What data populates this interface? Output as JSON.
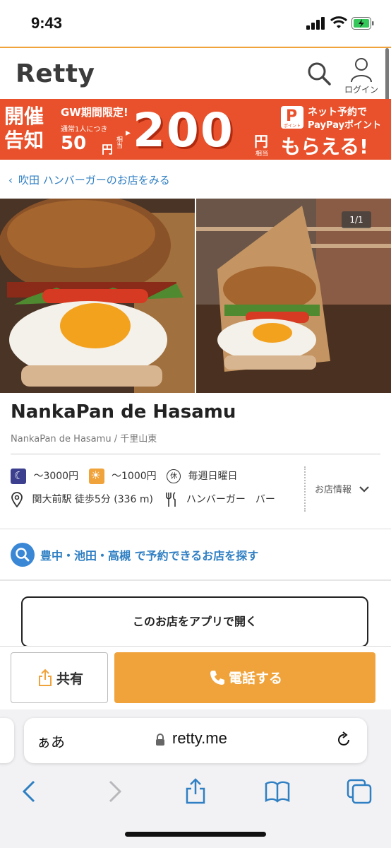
{
  "status": {
    "time": "9:43"
  },
  "header": {
    "logo": "Retty",
    "login": "ログイン"
  },
  "banner": {
    "announce": "開催\n告知",
    "gw": "GW期間限定!",
    "per_person": "通常1人につき",
    "base_points": "50",
    "yen": "円",
    "equiv": "相当",
    "big_points": "200",
    "yen2": "円",
    "equiv2": "相当",
    "paypay_icon_text": "ポイント",
    "net_reserve": "ネット予約で",
    "paypay_point": "PayPayポイント",
    "get": "もらえる!"
  },
  "breadcrumb": {
    "label": "吹田 ハンバーガーのお店をみる"
  },
  "photos": {
    "counter": "1/1"
  },
  "restaurant": {
    "name": "NankaPan de Hasamu",
    "subtitle": "NankaPan de Hasamu / 千里山東",
    "dinner_budget": "～3000円",
    "lunch_budget": "～1000円",
    "closed_icon": "休",
    "closed_day": "毎週日曜日",
    "access": "関大前駅 徒歩5分 (336 m)",
    "genre": "ハンバーガー　バー",
    "shop_info": "お店情報"
  },
  "find": {
    "label": "豊中・池田・高槻 で予約できるお店を探す"
  },
  "open_app": {
    "label": "このお店をアプリで開く"
  },
  "actions": {
    "share": "共有",
    "call": "電話する"
  },
  "browser": {
    "aa": "ぁあ",
    "url": "retty.me"
  },
  "colors": {
    "accent": "#f0a33a",
    "banner": "#e8512b",
    "link": "#2f7fc3",
    "moon": "#3b3f8e"
  }
}
